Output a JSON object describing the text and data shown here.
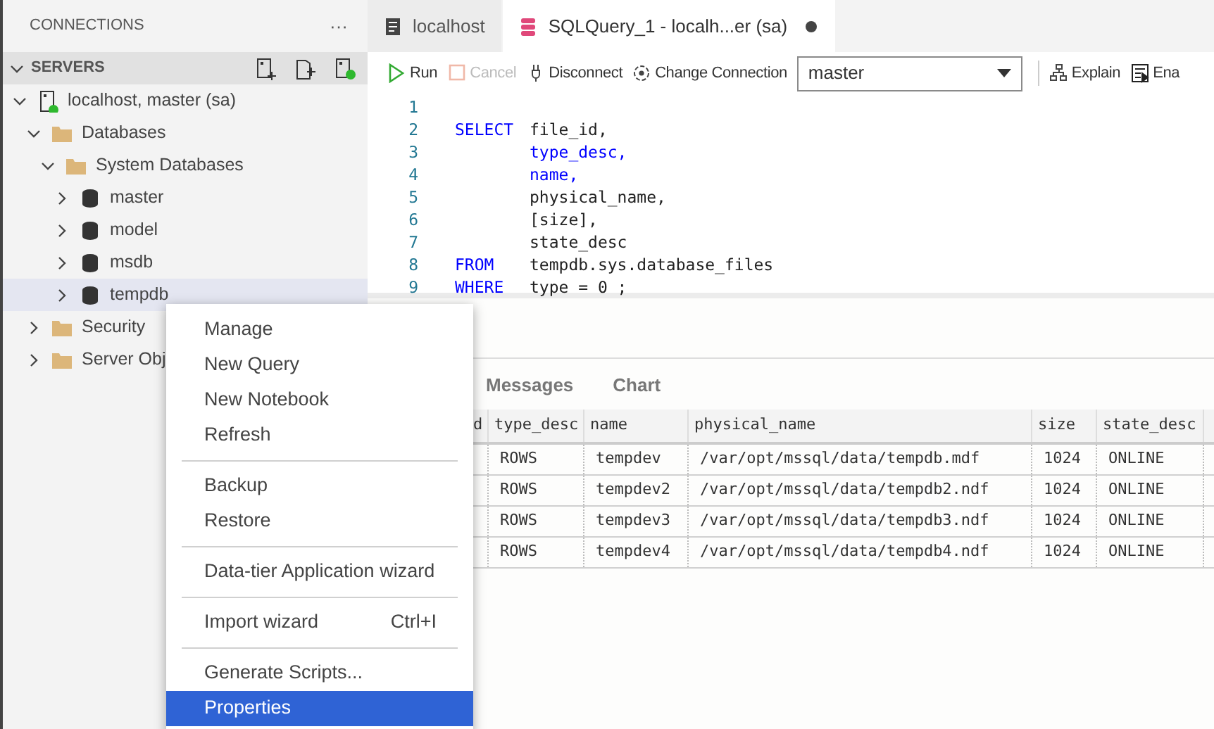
{
  "sidebar": {
    "title": "CONNECTIONS",
    "more": "···",
    "section": {
      "title": "SERVERS",
      "expanded": true
    },
    "tree": [
      {
        "label": "localhost, master (sa)",
        "kind": "server",
        "expanded": true,
        "selected": false,
        "children": [
          {
            "label": "Databases",
            "kind": "folder",
            "expanded": true,
            "selected": false,
            "children": [
              {
                "label": "System Databases",
                "kind": "folder",
                "expanded": true,
                "selected": false,
                "children": [
                  {
                    "label": "master",
                    "kind": "database",
                    "expanded": false,
                    "selected": false
                  },
                  {
                    "label": "model",
                    "kind": "database",
                    "expanded": false,
                    "selected": false
                  },
                  {
                    "label": "msdb",
                    "kind": "database",
                    "expanded": false,
                    "selected": false
                  },
                  {
                    "label": "tempdb",
                    "kind": "database",
                    "expanded": false,
                    "selected": true
                  }
                ]
              }
            ]
          },
          {
            "label": "Security",
            "kind": "folder",
            "expanded": false,
            "selected": false
          },
          {
            "label": "Server Obj",
            "kind": "folder",
            "expanded": false,
            "selected": false
          }
        ]
      }
    ]
  },
  "tabs": [
    {
      "label": "localhost",
      "kind": "dashboard",
      "selected": false,
      "dirty": false
    },
    {
      "label": "SQLQuery_1 - localh...er (sa)",
      "kind": "query",
      "selected": true,
      "dirty": true
    }
  ],
  "toolbar": [
    {
      "label": "Run",
      "kind": "run",
      "disabled": false
    },
    {
      "label": "Cancel",
      "kind": "cancel",
      "disabled": true
    },
    {
      "label": "Disconnect",
      "kind": "disconnect",
      "disabled": false
    },
    {
      "label": "Change Connection",
      "kind": "change",
      "disabled": false
    },
    {
      "kind": "select",
      "value": "master",
      "disabled": false
    },
    {
      "kind": "separator"
    },
    {
      "label": "Explain",
      "kind": "explain",
      "disabled": false
    },
    {
      "label": "Ena",
      "kind": "enable",
      "disabled": false
    }
  ],
  "editor": {
    "lines": [
      {
        "number": "1"
      },
      {
        "number": "2",
        "keyword": "SELECT",
        "tokens": [
          {
            "text": "file_id,",
            "kind": "plain"
          }
        ]
      },
      {
        "number": "3",
        "tokens": [
          {
            "text": "type_desc,",
            "kind": "keyword"
          }
        ]
      },
      {
        "number": "4",
        "tokens": [
          {
            "text": "name,",
            "kind": "keyword"
          }
        ]
      },
      {
        "number": "5",
        "tokens": [
          {
            "text": "physical_name,",
            "kind": "plain"
          }
        ]
      },
      {
        "number": "6",
        "tokens": [
          {
            "text": "[size],",
            "kind": "plain"
          }
        ]
      },
      {
        "number": "7",
        "tokens": [
          {
            "text": "state_desc",
            "kind": "plain"
          }
        ]
      },
      {
        "number": "8",
        "keyword": "FROM",
        "tokens": [
          {
            "text": "tempdb.sys.database_files",
            "kind": "plain"
          }
        ]
      },
      {
        "number": "9",
        "keyword": "WHERE",
        "tokens": [
          {
            "text": "type = 0 ;",
            "kind": "plain"
          }
        ]
      }
    ]
  },
  "results": {
    "tabs": [
      {
        "label": "Messages",
        "selected": false
      },
      {
        "label": "Chart",
        "selected": false
      }
    ],
    "table": {
      "columns": [
        "d",
        "type_desc",
        "name",
        "physical_name",
        "size",
        "state_desc"
      ],
      "rows": [
        [
          "",
          "ROWS",
          "tempdev",
          "/var/opt/mssql/data/tempdb.mdf",
          "1024",
          "ONLINE"
        ],
        [
          "",
          "ROWS",
          "tempdev2",
          "/var/opt/mssql/data/tempdb2.ndf",
          "1024",
          "ONLINE"
        ],
        [
          "",
          "ROWS",
          "tempdev3",
          "/var/opt/mssql/data/tempdb3.ndf",
          "1024",
          "ONLINE"
        ],
        [
          "",
          "ROWS",
          "tempdev4",
          "/var/opt/mssql/data/tempdb4.ndf",
          "1024",
          "ONLINE"
        ]
      ]
    }
  },
  "context_menu": {
    "groups": [
      [
        {
          "label": "Manage",
          "selected": false
        },
        {
          "label": "New Query",
          "selected": false
        },
        {
          "label": "New Notebook",
          "selected": false
        },
        {
          "label": "Refresh",
          "selected": false
        }
      ],
      [
        {
          "label": "Backup",
          "selected": false
        },
        {
          "label": "Restore",
          "selected": false
        }
      ],
      [
        {
          "label": "Data-tier Application wizard",
          "selected": false
        }
      ],
      [
        {
          "label": "Import wizard",
          "shortcut": "Ctrl+I",
          "selected": false
        }
      ],
      [
        {
          "label": "Generate Scripts...",
          "selected": false
        },
        {
          "label": "Properties",
          "selected": true
        }
      ]
    ]
  }
}
